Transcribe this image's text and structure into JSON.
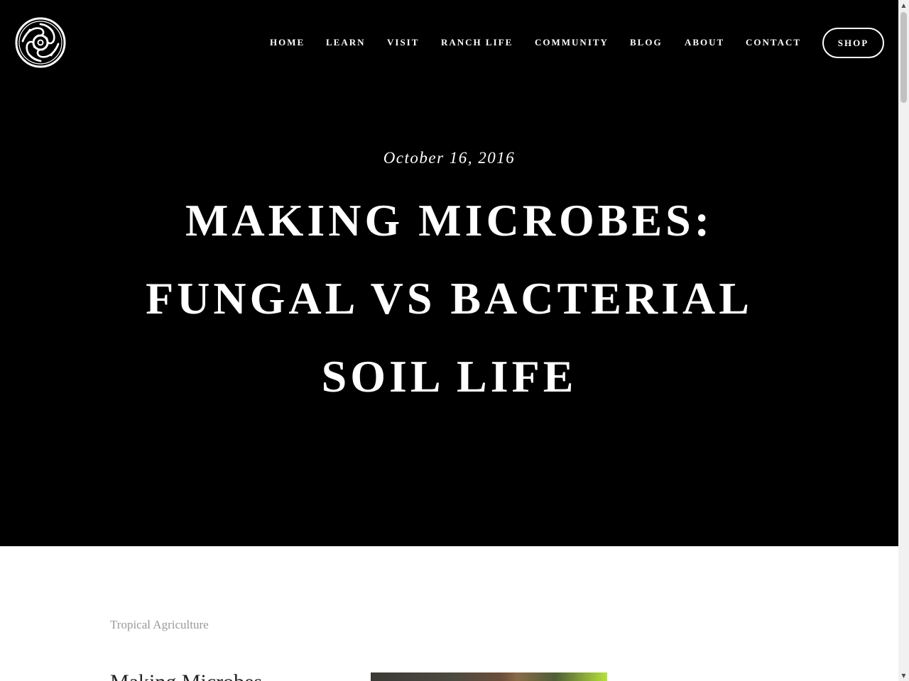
{
  "header": {
    "logo_icon": "celtic-knot-emblem-icon",
    "nav": {
      "home": "HOME",
      "learn": "LEARN",
      "visit": "VISIT",
      "ranch_life": "RANCH LIFE",
      "community": "COMMUNITY",
      "blog": "BLOG",
      "about": "ABOUT",
      "contact": "CONTACT"
    },
    "shop_label": "SHOP"
  },
  "hero": {
    "date": "October 16, 2016",
    "title_lines": [
      "MAKING MICROBES:",
      "FUNGAL VS BACTERIAL",
      "SOIL LIFE"
    ]
  },
  "content": {
    "category": "Tropical Agriculture",
    "heading": "Making Microbes"
  },
  "colors": {
    "hero_background": "#000000",
    "hero_text": "#ffffff",
    "category_text": "#9a9a9a",
    "page_background": "#ffffff"
  }
}
